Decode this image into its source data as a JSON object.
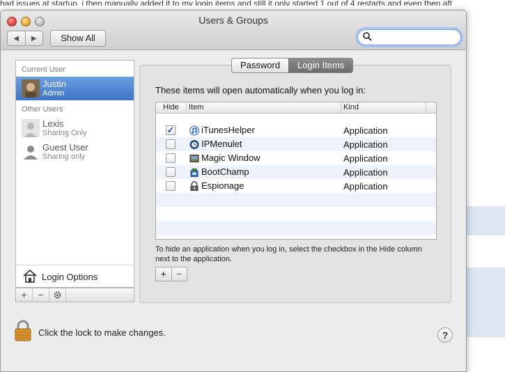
{
  "background": {
    "snippet": "had issues at startup, i then manually added it to my login items and still it only started 1 out of 4 restarts and even then aft"
  },
  "window": {
    "title": "Users & Groups",
    "show_all_label": "Show All",
    "search_placeholder": ""
  },
  "sidebar": {
    "current_user_header": "Current User",
    "other_users_header": "Other Users",
    "users": [
      {
        "name": "Justin",
        "role": "Admin",
        "selected": true
      },
      {
        "name": "Lexis",
        "role": "Sharing Only",
        "selected": false
      },
      {
        "name": "Guest User",
        "role": "Sharing only",
        "selected": false
      }
    ],
    "login_options_label": "Login Options",
    "tools": {
      "add": "+",
      "remove": "−",
      "gear_icon": "gear-icon"
    }
  },
  "tabs": [
    {
      "label": "Password",
      "active": false
    },
    {
      "label": "Login Items",
      "active": true
    }
  ],
  "login_items": {
    "heading": "These items will open automatically when you log in:",
    "columns": [
      "Hide",
      "Item",
      "Kind"
    ],
    "rows": [
      {
        "hide": true,
        "item": "iTunesHelper",
        "kind": "Application",
        "icon": "itunes-icon"
      },
      {
        "hide": false,
        "item": "IPMenulet",
        "kind": "Application",
        "icon": "ipmenulet-icon"
      },
      {
        "hide": false,
        "item": "Magic Window",
        "kind": "Application",
        "icon": "magic-window-icon"
      },
      {
        "hide": false,
        "item": "BootChamp",
        "kind": "Application",
        "icon": "bootchamp-icon"
      },
      {
        "hide": false,
        "item": "Espionage",
        "kind": "Application",
        "icon": "espionage-icon"
      }
    ],
    "help_text": "To hide an application when you log in, select the checkbox in the Hide column next to the application.",
    "add_label": "+",
    "remove_label": "−"
  },
  "footer": {
    "lock_text": "Click the lock to make changes.",
    "help_label": "?"
  },
  "colors": {
    "selection": "#3e74c6",
    "checkmark": "#2456b8"
  }
}
